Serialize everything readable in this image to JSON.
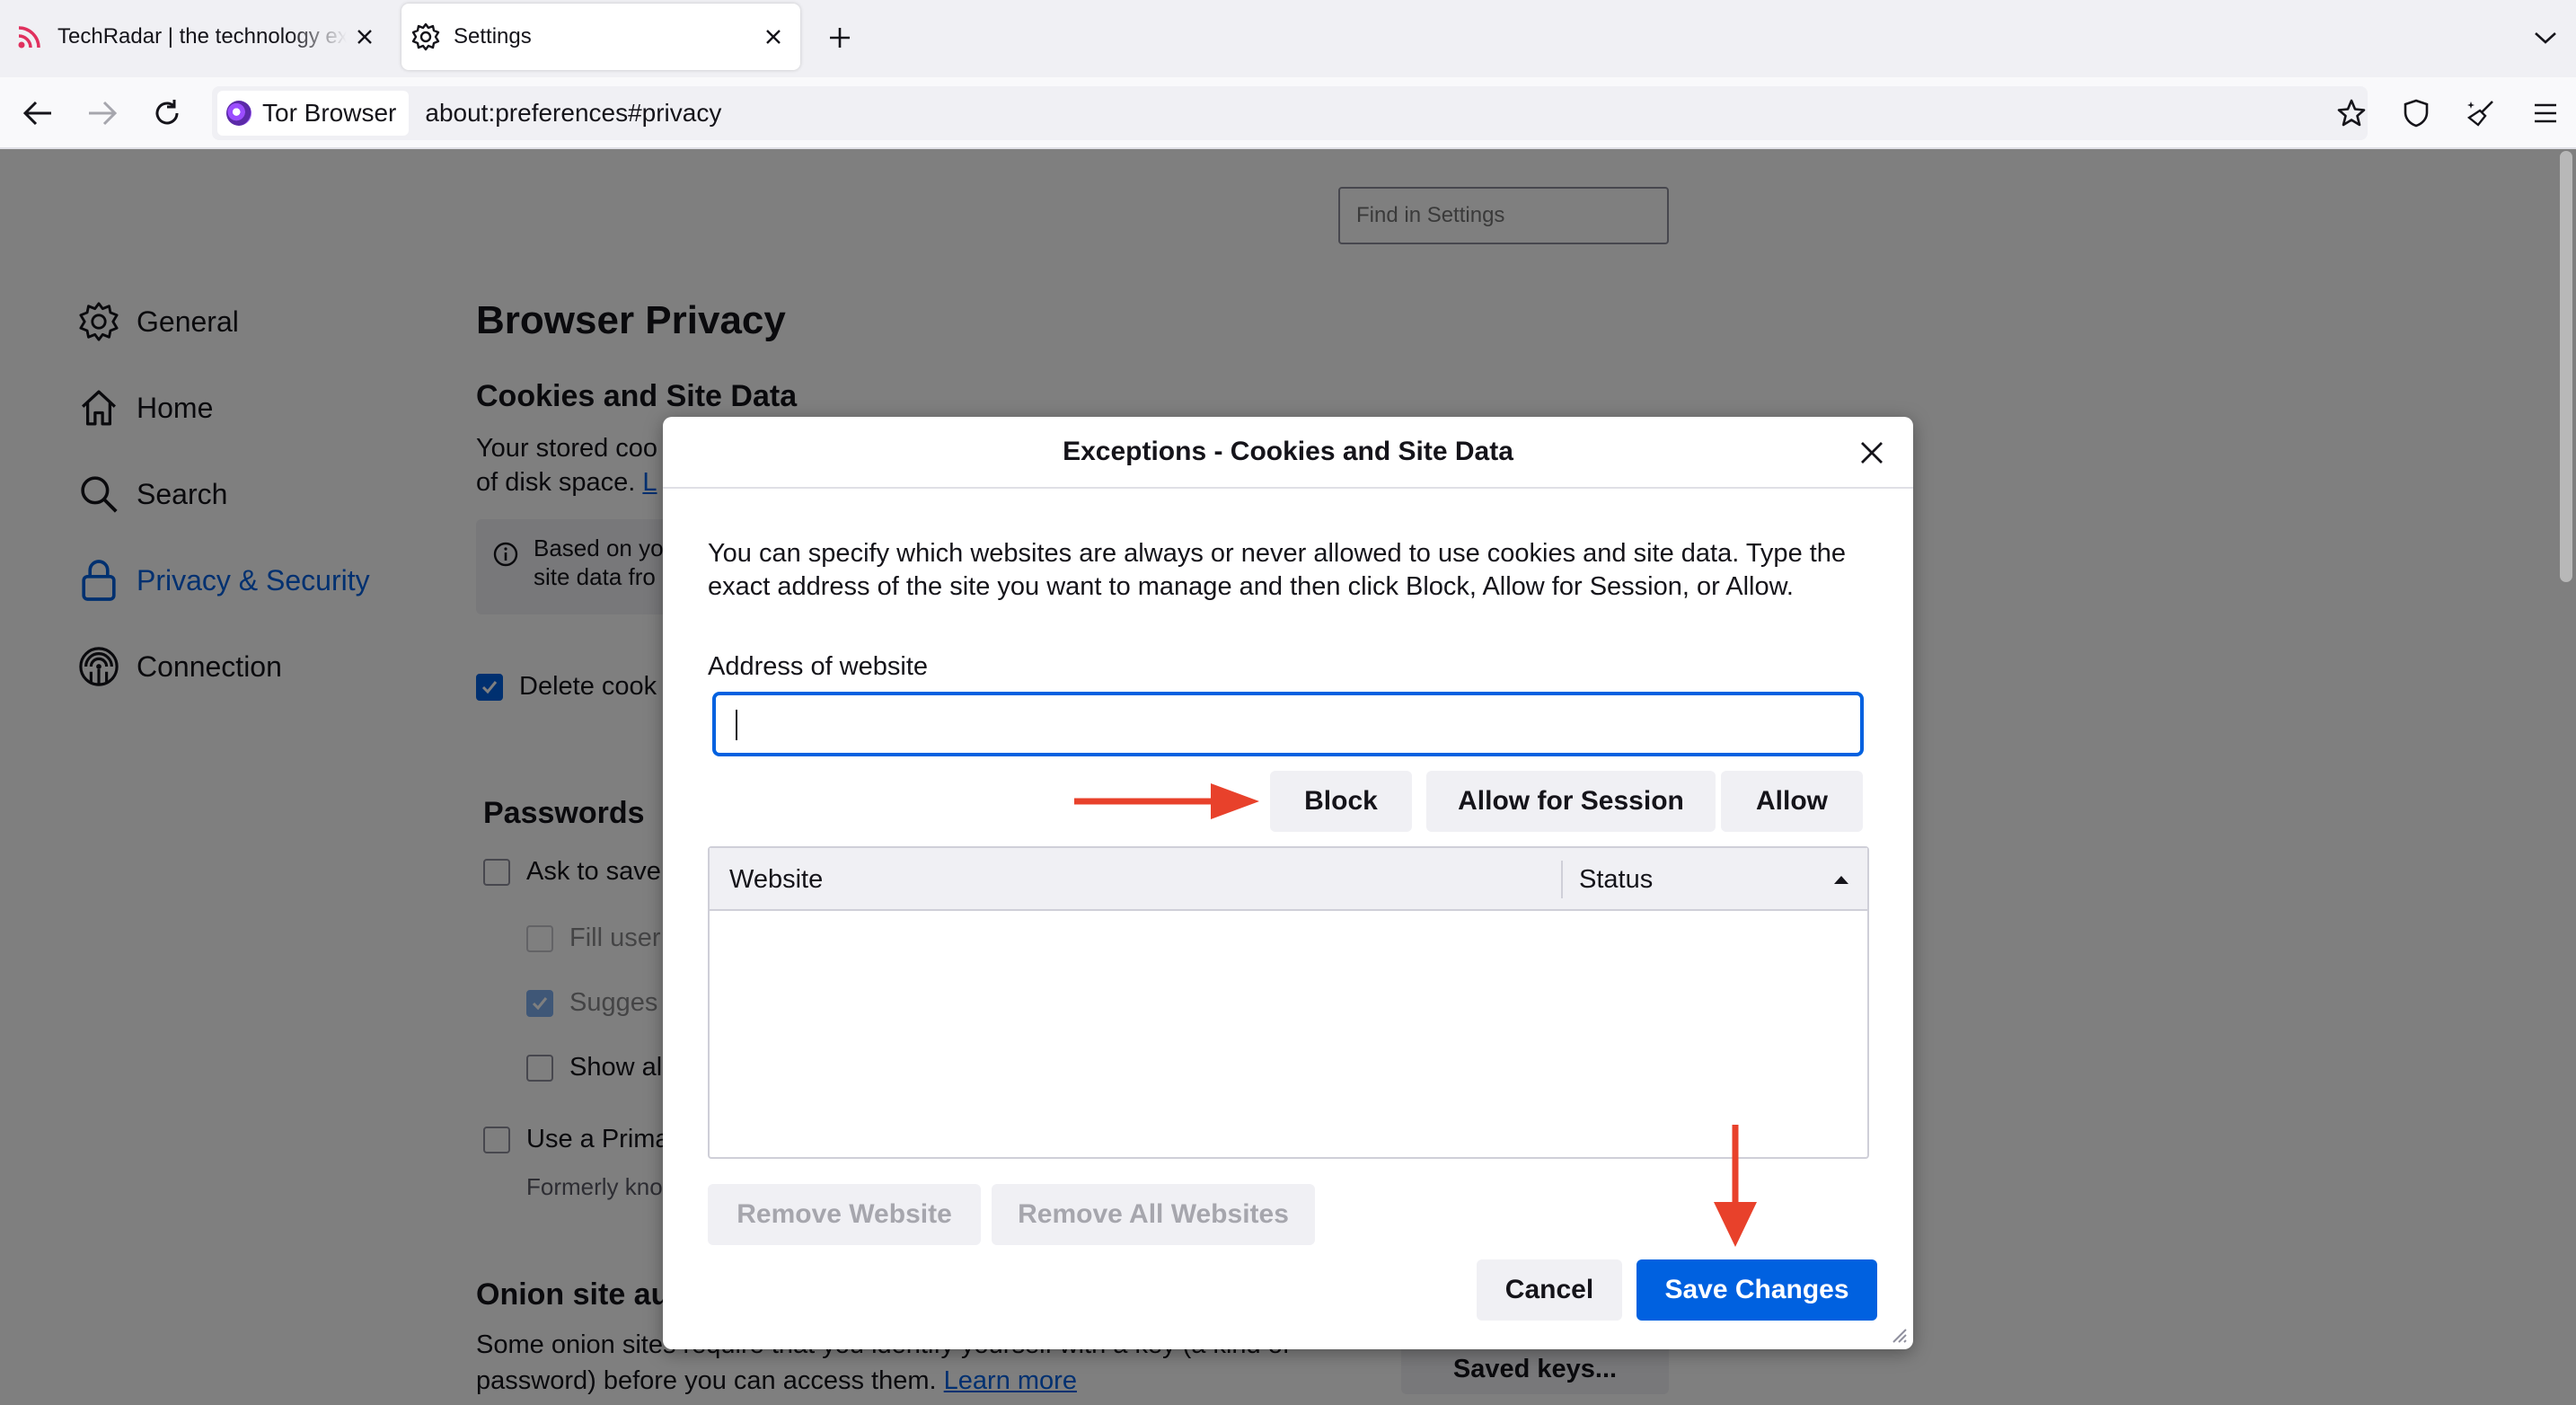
{
  "tabs": [
    {
      "title": "TechRadar | the technology experts",
      "icon": "rss-icon",
      "active": false
    },
    {
      "title": "Settings",
      "icon": "gear-icon",
      "active": true
    }
  ],
  "toolbar": {
    "identity_label": "Tor Browser",
    "url": "about:preferences#privacy"
  },
  "search": {
    "placeholder": "Find in Settings"
  },
  "sidebar": {
    "items": [
      {
        "label": "General",
        "icon": "gear-icon"
      },
      {
        "label": "Home",
        "icon": "home-icon"
      },
      {
        "label": "Search",
        "icon": "search-icon"
      },
      {
        "label": "Privacy & Security",
        "icon": "lock-icon",
        "selected": true
      },
      {
        "label": "Connection",
        "icon": "onion-connection-icon"
      }
    ]
  },
  "page": {
    "title": "Browser Privacy",
    "cookies_heading": "Cookies and Site Data",
    "cookies_text_1": "Your stored coo",
    "cookies_text_2": "of disk space.",
    "cookies_link": "L",
    "info_line_1": "Based on yo",
    "info_line_2": "site data fro",
    "delete_cookies": "Delete cook",
    "passwords_heading": "Passwords",
    "ask_to_save": "Ask to save",
    "fill_user": "Fill user",
    "suggest": "Sugges",
    "show_alerts": "Show al",
    "use_primary": "Use a Prima",
    "formerly": "Formerly kno",
    "onion_heading": "Onion site au",
    "onion_text_1": "Some onion sites require that you identify yourself with a key (a kind of",
    "onion_text_2": "password) before you can access them.",
    "learn_more": "Learn more",
    "saved_keys": "Saved keys..."
  },
  "dialog": {
    "title": "Exceptions - Cookies and Site Data",
    "description": "You can specify which websites are always or never allowed to use cookies and site data. Type the exact address of the site you want to manage and then click Block, Allow for Session, or Allow.",
    "address_label": "Address of website",
    "address_value": "",
    "block_label": "Block",
    "allow_session_label": "Allow for Session",
    "allow_label": "Allow",
    "col_website": "Website",
    "col_status": "Status",
    "remove_website": "Remove Website",
    "remove_all": "Remove All Websites",
    "cancel": "Cancel",
    "save": "Save Changes"
  },
  "colors": {
    "accent": "#0061e0",
    "annotation_arrow": "#e8412b"
  }
}
